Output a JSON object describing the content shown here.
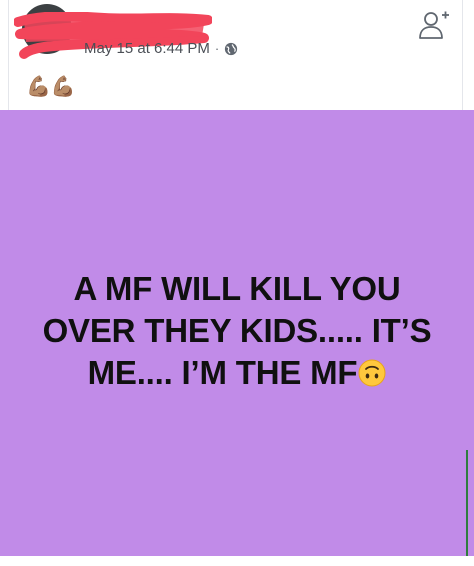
{
  "post": {
    "timestamp": "May 15 at 6:44 PM",
    "separator": "·",
    "privacy_icon": "globe-icon",
    "caption": "💪🏽💪🏽",
    "header_action_icon": "add-friend-icon",
    "background_text": {
      "line1": "A MF WILL KILL YOU",
      "line2": "OVER THEY KIDS..... IT’S",
      "line3": "ME.... I’M THE MF"
    },
    "background_color": "#c18be8"
  }
}
